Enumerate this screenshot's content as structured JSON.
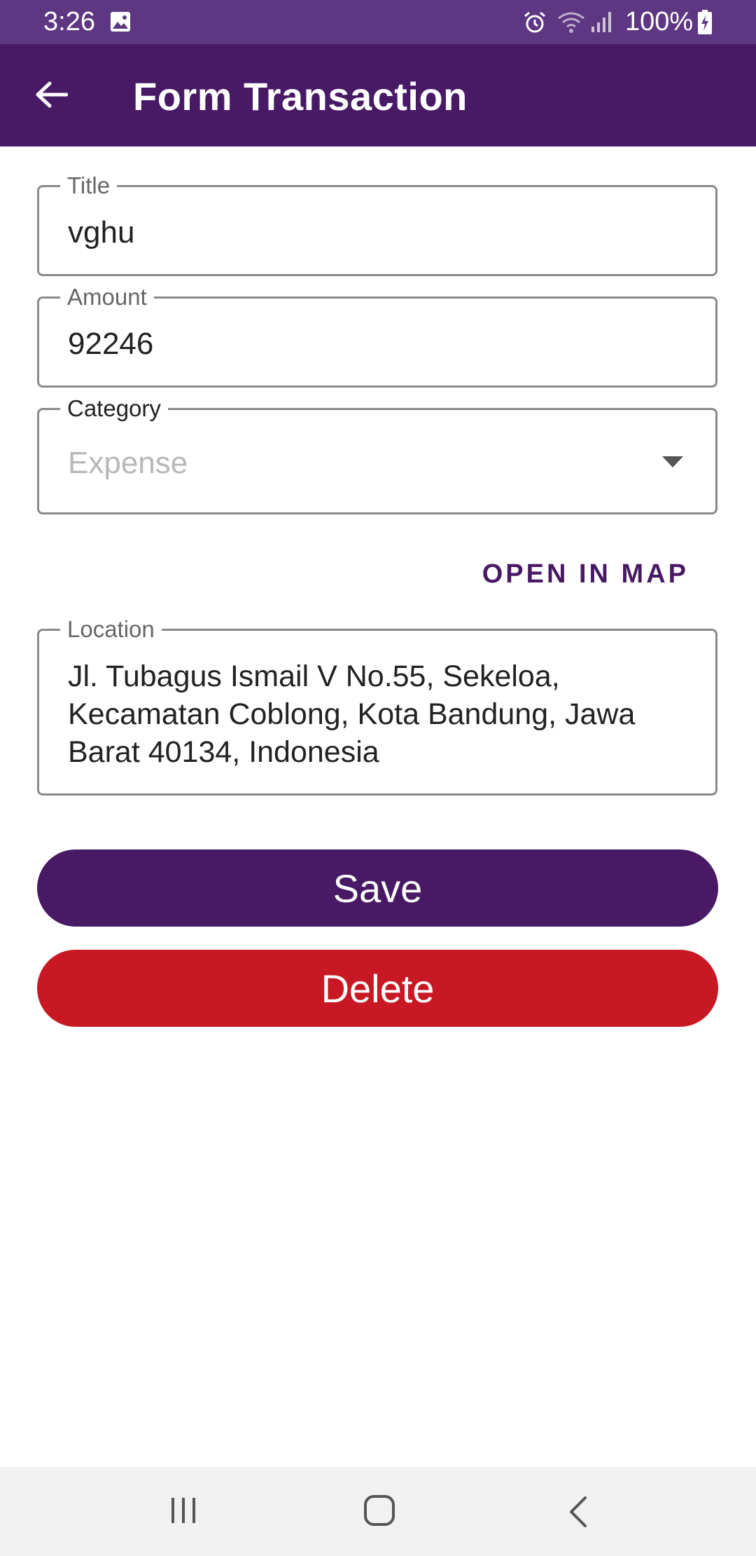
{
  "status_bar": {
    "time": "3:26",
    "battery": "100%",
    "icons": [
      "gallery-icon",
      "alarm-icon",
      "wifi-icon",
      "signal-icon",
      "battery-charging-icon"
    ]
  },
  "app_bar": {
    "title": "Form Transaction",
    "back_icon": "arrow-left-icon"
  },
  "form": {
    "title_field": {
      "label": "Title",
      "value": "vghu"
    },
    "amount_field": {
      "label": "Amount",
      "value": "92246"
    },
    "category_field": {
      "label": "Category",
      "value": "Expense"
    },
    "open_in_map": "OPEN IN MAP",
    "location_field": {
      "label": "Location",
      "value": "Jl. Tubagus Ismail V No.55, Sekeloa, Kecamatan Coblong, Kota Bandung, Jawa Barat 40134, Indonesia"
    }
  },
  "buttons": {
    "save": "Save",
    "delete": "Delete"
  },
  "nav_bar": {
    "icons": [
      "recents-icon",
      "home-icon",
      "back-icon"
    ]
  },
  "colors": {
    "status_bar": "#5e3782",
    "primary": "#481a66",
    "danger": "#c81824"
  }
}
